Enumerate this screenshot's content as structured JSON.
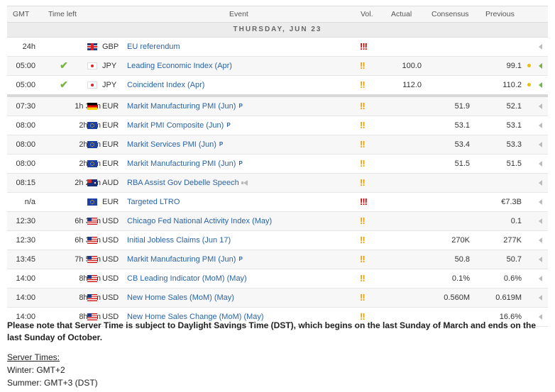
{
  "headers": {
    "gmt": "GMT",
    "time_left": "Time left",
    "event": "Event",
    "vol": "Vol.",
    "actual": "Actual",
    "consensus": "Consensus",
    "previous": "Previous"
  },
  "date_label": "THURSDAY, JUN 23",
  "rows": [
    {
      "gmt": "24h",
      "time_left": "",
      "check": false,
      "flag": "gb",
      "currency": "GBP",
      "event": "EU referendum",
      "badge": "",
      "speaker": false,
      "volatility": "high",
      "vol_marks": "!!!",
      "actual": "",
      "consensus": "",
      "previous": "",
      "dot": false,
      "arrow": "grey"
    },
    {
      "gmt": "05:00",
      "time_left": "",
      "check": true,
      "flag": "jp",
      "currency": "JPY",
      "event": "Leading Economic Index (Apr)",
      "badge": "",
      "speaker": false,
      "volatility": "medium",
      "vol_marks": "!!",
      "actual": "100.0",
      "consensus": "",
      "previous": "99.1",
      "dot": true,
      "arrow": "green"
    },
    {
      "gmt": "05:00",
      "time_left": "",
      "check": true,
      "flag": "jp",
      "currency": "JPY",
      "event": "Coincident Index (Apr)",
      "badge": "",
      "speaker": false,
      "volatility": "medium",
      "vol_marks": "!!",
      "actual": "112.0",
      "consensus": "",
      "previous": "110.2",
      "dot": true,
      "arrow": "green"
    },
    {
      "gmt": "07:30",
      "time_left": "1h 39m",
      "check": false,
      "flag": "de",
      "currency": "EUR",
      "event": "Markit Manufacturing PMI (Jun)",
      "badge": "P",
      "speaker": false,
      "volatility": "medium",
      "vol_marks": "!!",
      "actual": "",
      "consensus": "51.9",
      "previous": "52.1",
      "dot": false,
      "arrow": "grey"
    },
    {
      "gmt": "08:00",
      "time_left": "2h 9m",
      "check": false,
      "flag": "eu",
      "currency": "EUR",
      "event": "Markit PMI Composite (Jun)",
      "badge": "P",
      "speaker": false,
      "volatility": "medium",
      "vol_marks": "!!",
      "actual": "",
      "consensus": "53.1",
      "previous": "53.1",
      "dot": false,
      "arrow": "grey"
    },
    {
      "gmt": "08:00",
      "time_left": "2h 9m",
      "check": false,
      "flag": "eu",
      "currency": "EUR",
      "event": "Markit Services PMI (Jun)",
      "badge": "P",
      "speaker": false,
      "volatility": "medium",
      "vol_marks": "!!",
      "actual": "",
      "consensus": "53.4",
      "previous": "53.3",
      "dot": false,
      "arrow": "grey"
    },
    {
      "gmt": "08:00",
      "time_left": "2h 9m",
      "check": false,
      "flag": "eu",
      "currency": "EUR",
      "event": "Markit Manufacturing PMI (Jun)",
      "badge": "P",
      "speaker": false,
      "volatility": "medium",
      "vol_marks": "!!",
      "actual": "",
      "consensus": "51.5",
      "previous": "51.5",
      "dot": false,
      "arrow": "grey"
    },
    {
      "gmt": "08:15",
      "time_left": "2h 24m",
      "check": false,
      "flag": "au",
      "currency": "AUD",
      "event": "RBA Assist Gov Debelle Speech",
      "badge": "",
      "speaker": true,
      "volatility": "medium",
      "vol_marks": "!!",
      "actual": "",
      "consensus": "",
      "previous": "",
      "dot": false,
      "arrow": "grey"
    },
    {
      "gmt": "n/a",
      "time_left": "",
      "check": false,
      "flag": "eu",
      "currency": "EUR",
      "event": "Targeted LTRO",
      "badge": "",
      "speaker": false,
      "volatility": "high",
      "vol_marks": "!!!",
      "actual": "",
      "consensus": "",
      "previous": "€7.3B",
      "dot": false,
      "arrow": "grey"
    },
    {
      "gmt": "12:30",
      "time_left": "6h 39m",
      "check": false,
      "flag": "us",
      "currency": "USD",
      "event": "Chicago Fed National Activity Index (May)",
      "badge": "",
      "speaker": false,
      "volatility": "medium",
      "vol_marks": "!!",
      "actual": "",
      "consensus": "",
      "previous": "0.1",
      "dot": false,
      "arrow": "grey"
    },
    {
      "gmt": "12:30",
      "time_left": "6h 39m",
      "check": false,
      "flag": "us",
      "currency": "USD",
      "event": "Initial Jobless Claims (Jun 17)",
      "badge": "",
      "speaker": false,
      "volatility": "medium",
      "vol_marks": "!!",
      "actual": "",
      "consensus": "270K",
      "previous": "277K",
      "dot": false,
      "arrow": "grey"
    },
    {
      "gmt": "13:45",
      "time_left": "7h 54m",
      "check": false,
      "flag": "us",
      "currency": "USD",
      "event": "Markit Manufacturing PMI (Jun)",
      "badge": "P",
      "speaker": false,
      "volatility": "medium",
      "vol_marks": "!!",
      "actual": "",
      "consensus": "50.8",
      "previous": "50.7",
      "dot": false,
      "arrow": "grey"
    },
    {
      "gmt": "14:00",
      "time_left": "8h 9m",
      "check": false,
      "flag": "us",
      "currency": "USD",
      "event": "CB Leading Indicator (MoM) (May)",
      "badge": "",
      "speaker": false,
      "volatility": "medium",
      "vol_marks": "!!",
      "actual": "",
      "consensus": "0.1%",
      "previous": "0.6%",
      "dot": false,
      "arrow": "grey"
    },
    {
      "gmt": "14:00",
      "time_left": "8h 9m",
      "check": false,
      "flag": "us",
      "currency": "USD",
      "event": "New Home Sales (MoM) (May)",
      "badge": "",
      "speaker": false,
      "volatility": "medium",
      "vol_marks": "!!",
      "actual": "",
      "consensus": "0.560M",
      "previous": "0.619M",
      "dot": false,
      "arrow": "grey"
    },
    {
      "gmt": "14:00",
      "time_left": "8h 9m",
      "check": false,
      "flag": "us",
      "currency": "USD",
      "event": "New Home Sales Change (MoM) (May)",
      "badge": "",
      "speaker": false,
      "volatility": "medium",
      "vol_marks": "!!",
      "actual": "",
      "consensus": "",
      "previous": "16.6%",
      "dot": false,
      "arrow": "grey"
    }
  ],
  "note": "Please note that Server Time is subject to Daylight Savings Time (DST), which begins on the last Sunday of March and ends on the last Sunday of October.",
  "server_times_label": "Server Times:",
  "winter": "Winter: GMT+2",
  "summer": "Summer: GMT+3 (DST)",
  "colors": {
    "event_link": "#2a64a6",
    "vol_high": "#cc0000",
    "vol_medium": "#e8a100",
    "check": "#7cb342",
    "dot": "#e8c000"
  }
}
